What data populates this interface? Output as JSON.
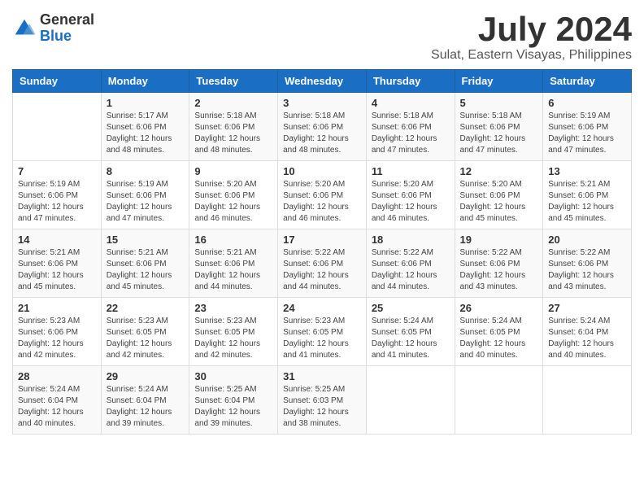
{
  "logo": {
    "general": "General",
    "blue": "Blue"
  },
  "title": "July 2024",
  "location": "Sulat, Eastern Visayas, Philippines",
  "days_header": [
    "Sunday",
    "Monday",
    "Tuesday",
    "Wednesday",
    "Thursday",
    "Friday",
    "Saturday"
  ],
  "weeks": [
    [
      {
        "day": "",
        "info": ""
      },
      {
        "day": "1",
        "info": "Sunrise: 5:17 AM\nSunset: 6:06 PM\nDaylight: 12 hours\nand 48 minutes."
      },
      {
        "day": "2",
        "info": "Sunrise: 5:18 AM\nSunset: 6:06 PM\nDaylight: 12 hours\nand 48 minutes."
      },
      {
        "day": "3",
        "info": "Sunrise: 5:18 AM\nSunset: 6:06 PM\nDaylight: 12 hours\nand 48 minutes."
      },
      {
        "day": "4",
        "info": "Sunrise: 5:18 AM\nSunset: 6:06 PM\nDaylight: 12 hours\nand 47 minutes."
      },
      {
        "day": "5",
        "info": "Sunrise: 5:18 AM\nSunset: 6:06 PM\nDaylight: 12 hours\nand 47 minutes."
      },
      {
        "day": "6",
        "info": "Sunrise: 5:19 AM\nSunset: 6:06 PM\nDaylight: 12 hours\nand 47 minutes."
      }
    ],
    [
      {
        "day": "7",
        "info": ""
      },
      {
        "day": "8",
        "info": "Sunrise: 5:19 AM\nSunset: 6:06 PM\nDaylight: 12 hours\nand 47 minutes."
      },
      {
        "day": "9",
        "info": "Sunrise: 5:20 AM\nSunset: 6:06 PM\nDaylight: 12 hours\nand 46 minutes."
      },
      {
        "day": "10",
        "info": "Sunrise: 5:20 AM\nSunset: 6:06 PM\nDaylight: 12 hours\nand 46 minutes."
      },
      {
        "day": "11",
        "info": "Sunrise: 5:20 AM\nSunset: 6:06 PM\nDaylight: 12 hours\nand 46 minutes."
      },
      {
        "day": "12",
        "info": "Sunrise: 5:20 AM\nSunset: 6:06 PM\nDaylight: 12 hours\nand 45 minutes."
      },
      {
        "day": "13",
        "info": "Sunrise: 5:21 AM\nSunset: 6:06 PM\nDaylight: 12 hours\nand 45 minutes."
      }
    ],
    [
      {
        "day": "14",
        "info": ""
      },
      {
        "day": "15",
        "info": "Sunrise: 5:21 AM\nSunset: 6:06 PM\nDaylight: 12 hours\nand 45 minutes."
      },
      {
        "day": "16",
        "info": "Sunrise: 5:21 AM\nSunset: 6:06 PM\nDaylight: 12 hours\nand 44 minutes."
      },
      {
        "day": "17",
        "info": "Sunrise: 5:22 AM\nSunset: 6:06 PM\nDaylight: 12 hours\nand 44 minutes."
      },
      {
        "day": "18",
        "info": "Sunrise: 5:22 AM\nSunset: 6:06 PM\nDaylight: 12 hours\nand 44 minutes."
      },
      {
        "day": "19",
        "info": "Sunrise: 5:22 AM\nSunset: 6:06 PM\nDaylight: 12 hours\nand 43 minutes."
      },
      {
        "day": "20",
        "info": "Sunrise: 5:22 AM\nSunset: 6:06 PM\nDaylight: 12 hours\nand 43 minutes."
      }
    ],
    [
      {
        "day": "21",
        "info": ""
      },
      {
        "day": "22",
        "info": "Sunrise: 5:23 AM\nSunset: 6:05 PM\nDaylight: 12 hours\nand 42 minutes."
      },
      {
        "day": "23",
        "info": "Sunrise: 5:23 AM\nSunset: 6:05 PM\nDaylight: 12 hours\nand 42 minutes."
      },
      {
        "day": "24",
        "info": "Sunrise: 5:23 AM\nSunset: 6:05 PM\nDaylight: 12 hours\nand 41 minutes."
      },
      {
        "day": "25",
        "info": "Sunrise: 5:24 AM\nSunset: 6:05 PM\nDaylight: 12 hours\nand 41 minutes."
      },
      {
        "day": "26",
        "info": "Sunrise: 5:24 AM\nSunset: 6:05 PM\nDaylight: 12 hours\nand 40 minutes."
      },
      {
        "day": "27",
        "info": "Sunrise: 5:24 AM\nSunset: 6:04 PM\nDaylight: 12 hours\nand 40 minutes."
      }
    ],
    [
      {
        "day": "28",
        "info": "Sunrise: 5:24 AM\nSunset: 6:04 PM\nDaylight: 12 hours\nand 40 minutes."
      },
      {
        "day": "29",
        "info": "Sunrise: 5:24 AM\nSunset: 6:04 PM\nDaylight: 12 hours\nand 39 minutes."
      },
      {
        "day": "30",
        "info": "Sunrise: 5:25 AM\nSunset: 6:04 PM\nDaylight: 12 hours\nand 39 minutes."
      },
      {
        "day": "31",
        "info": "Sunrise: 5:25 AM\nSunset: 6:03 PM\nDaylight: 12 hours\nand 38 minutes."
      },
      {
        "day": "",
        "info": ""
      },
      {
        "day": "",
        "info": ""
      },
      {
        "day": "",
        "info": ""
      }
    ]
  ],
  "week7_sunday_info": "Sunrise: 5:19 AM\nSunset: 6:06 PM\nDaylight: 12 hours\nand 47 minutes.",
  "week14_sunday_info": "Sunrise: 5:21 AM\nSunset: 6:06 PM\nDaylight: 12 hours\nand 45 minutes.",
  "week21_sunday_info": "Sunrise: 5:23 AM\nSunset: 6:06 PM\nDaylight: 12 hours\nand 42 minutes."
}
